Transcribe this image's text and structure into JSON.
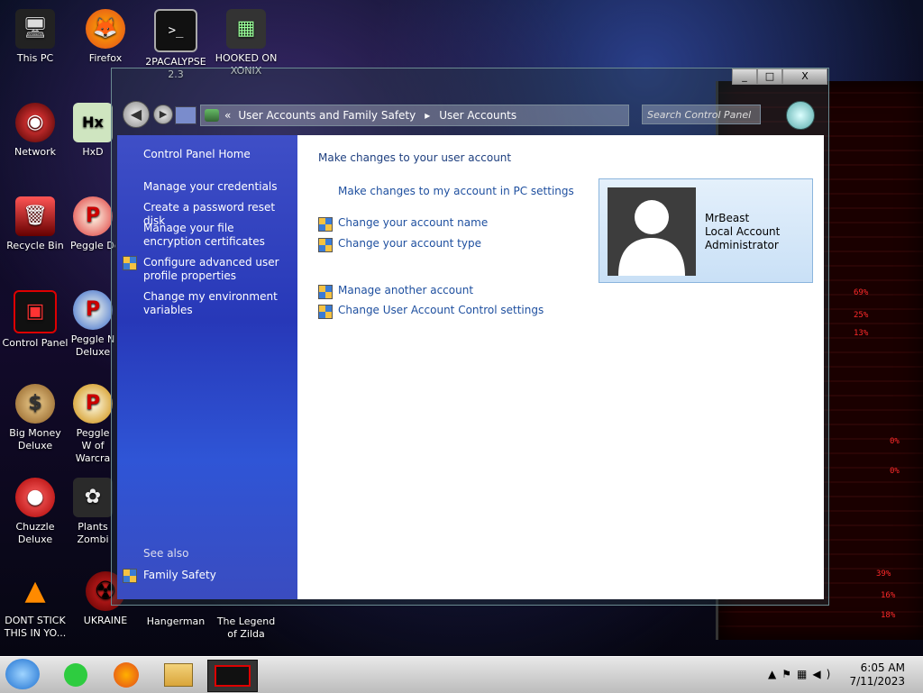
{
  "desktop": {
    "icons": [
      {
        "label": "This PC",
        "glyph": "🖥"
      },
      {
        "label": "Firefox",
        "glyph": "🦊"
      },
      {
        "label": "2PACALYPSE 2.3",
        "glyph": ">_"
      },
      {
        "label": "HOOKED ON XONIX",
        "glyph": "▦"
      },
      {
        "label": "Network",
        "glyph": "◉"
      },
      {
        "label": "HxD",
        "glyph": "Hx"
      },
      {
        "label": "Recycle Bin",
        "glyph": "🗑"
      },
      {
        "label": "Peggle De",
        "glyph": "P"
      },
      {
        "label": "Control Panel",
        "glyph": "▣"
      },
      {
        "label": "Peggle N Deluxe",
        "glyph": "P"
      },
      {
        "label": "Big Money Deluxe",
        "glyph": "$"
      },
      {
        "label": "Peggle W of Warcra",
        "glyph": "P"
      },
      {
        "label": "Chuzzle Deluxe",
        "glyph": "●"
      },
      {
        "label": "Plants Zombi",
        "glyph": "✿"
      },
      {
        "label": "DONT STICK THIS IN YO...",
        "glyph": "▲"
      },
      {
        "label": "UKRAINE",
        "glyph": "☢"
      },
      {
        "label": "Hangerman",
        "glyph": ""
      },
      {
        "label": "The Legend of Zilda",
        "glyph": ""
      }
    ]
  },
  "window": {
    "controls": {
      "minimize": "_",
      "maximize": "□",
      "close": "X"
    },
    "breadcrumb": [
      "User Accounts and Family Safety",
      "User Accounts"
    ],
    "search_placeholder": "Search Control Panel",
    "sidebar": {
      "home": "Control Panel Home",
      "links": [
        "Manage your credentials",
        "Create a password reset disk",
        "Manage your file encryption certificates",
        "Configure advanced user profile properties",
        "Change my environment variables"
      ],
      "see_also": "See also",
      "family_safety": "Family Safety"
    },
    "main": {
      "heading": "Make changes to your user account",
      "pc_settings_link": "Make changes to my account in PC settings",
      "change_name": "Change your account name",
      "change_type": "Change your account type",
      "manage_another": "Manage another account",
      "uac": "Change User Account Control settings"
    },
    "account": {
      "name": "MrBeast",
      "type": "Local Account",
      "role": "Administrator"
    }
  },
  "taskbar": {
    "time": "6:05 AM",
    "date": "7/11/2023"
  },
  "colors": {
    "link": "#1e4f9f",
    "sidebar": "#2f40bf"
  }
}
